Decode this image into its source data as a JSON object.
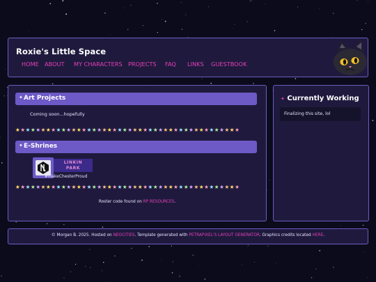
{
  "header": {
    "title": "Roxie's Little Space",
    "nav": [
      "HOME",
      "ABOUT",
      "MY CHARACTERS",
      "PROJECTS",
      "FAQ",
      "LINKS",
      "GUESTBOOK"
    ]
  },
  "main": {
    "art_projects": {
      "heading": "Art Projects",
      "body": "Coming soon...hopefully"
    },
    "eshrines": {
      "heading": "E-Shrines",
      "shrine_line1": "LINKIN",
      "shrine_line2": "PARK",
      "hashtag": "#MakeChesterProud"
    },
    "roster": {
      "prefix": "Roster code found on ",
      "link": "RP RESOURCES",
      "suffix": "."
    }
  },
  "sidebar": {
    "heading": "Currently Working",
    "item": "Finalizing this site, lol"
  },
  "footer": {
    "p1": "© Morgan B. 2025. Hosted on ",
    "l1": "NEOCITIES",
    "p2": ". Template generated with ",
    "l2": "PETRAPIXEL'S LAYOUT GENERATOR",
    "p3": ". Graphics credits located ",
    "l3": "HERE",
    "p4": "."
  },
  "icons": {
    "header_cat": "black-cat-icon",
    "section_bullet": "star-icon",
    "divider": "pastel-star-divider",
    "shrine_badge": "linkin-park-logo-icon"
  },
  "colors": {
    "background": "#0c0b1c",
    "panel": "#1f1a3d",
    "border": "#6a5ec4",
    "section_header": "#6d5ac6",
    "link": "#e43fb7",
    "text": "#e8e4ff"
  }
}
